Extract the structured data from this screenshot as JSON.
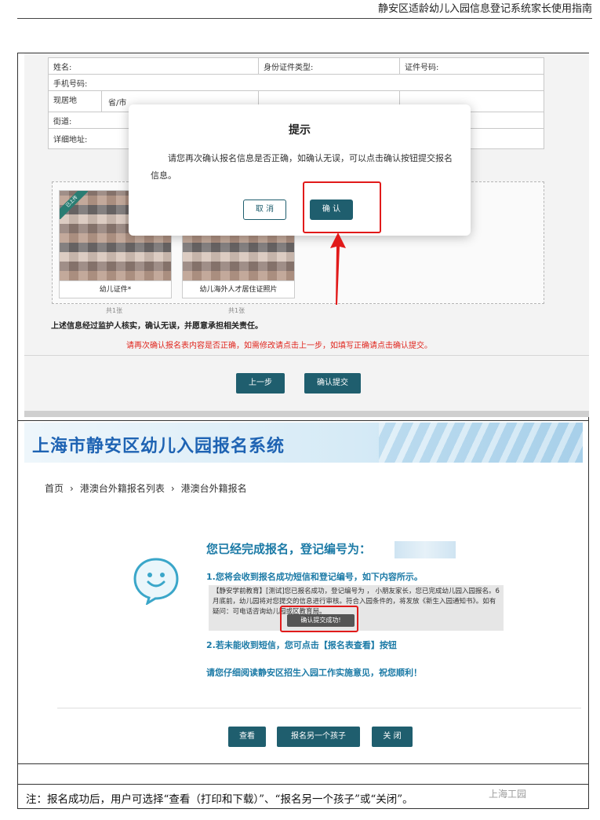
{
  "doc_header": "静安区适龄幼儿入园信息登记系统家长使用指南",
  "form": {
    "name_label": "姓名:",
    "id_type_label": "身份证件类型:",
    "id_no_label": "证件号码:",
    "phone_label": "手机号码:",
    "residence_label": "现居地",
    "province_placeholder": "省/市",
    "street_label": "街道:",
    "address_label": "详细地址:"
  },
  "photos": [
    {
      "ribbon": "已上传",
      "label": "幼儿证件*",
      "count": "共1张"
    },
    {
      "label": "幼儿海外人才居住证照片",
      "count": "共1张"
    }
  ],
  "confirm_statement": "上述信息经过监护人核实，确认无误，并愿意承担相关责任。",
  "warn_statement": "请再次确认报名表内容是否正确，如需修改请点击上一步，如填写正确请点击确认提交。",
  "buttons_top": {
    "prev": "上一步",
    "submit": "确认提交"
  },
  "modal": {
    "title": "提示",
    "body": "请您再次确认报名信息是否正确，如确认无误，可以点击确认按钮提交报名信息。",
    "cancel": "取 消",
    "ok": "确 认"
  },
  "banner_title": "上海市静安区幼儿入园报名系统",
  "breadcrumb": [
    "首页",
    "港澳台外籍报名列表",
    "港澳台外籍报名"
  ],
  "done": {
    "title": "您已经完成报名，登记编号为：",
    "step1": "1.您将会收到报名成功短信和登记编号，如下内容所示。",
    "sms": "【静安学前教育】[测试]您已报名成功，登记编号为            ，           小朋友家长，您已完成幼儿园入园报名。6月底前，幼儿园将对您提交的信息进行审核。符合入园条件的，将发放《新生入园通知书》。如有疑问：可电话咨询幼儿园或区教育局。",
    "toast": "确认提交成功!",
    "step2": "2.若未能收到短信，您可点击【报名表查看】按钮",
    "readme": "请您仔细阅读静安区招生入园工作实施意见，祝您顺利！"
  },
  "buttons_bottom": {
    "view": "查看",
    "another": "报名另一个孩子",
    "close": "关 闭"
  },
  "footnote": "注：报名成功后，用户可选择“查看（打印和下载）”、“报名另一个孩子”或“关闭”。",
  "watermark": "上海工园",
  "colors": {
    "teal": "#1f5e6e",
    "red": "#e11a1a",
    "blue": "#1b7aa6"
  }
}
